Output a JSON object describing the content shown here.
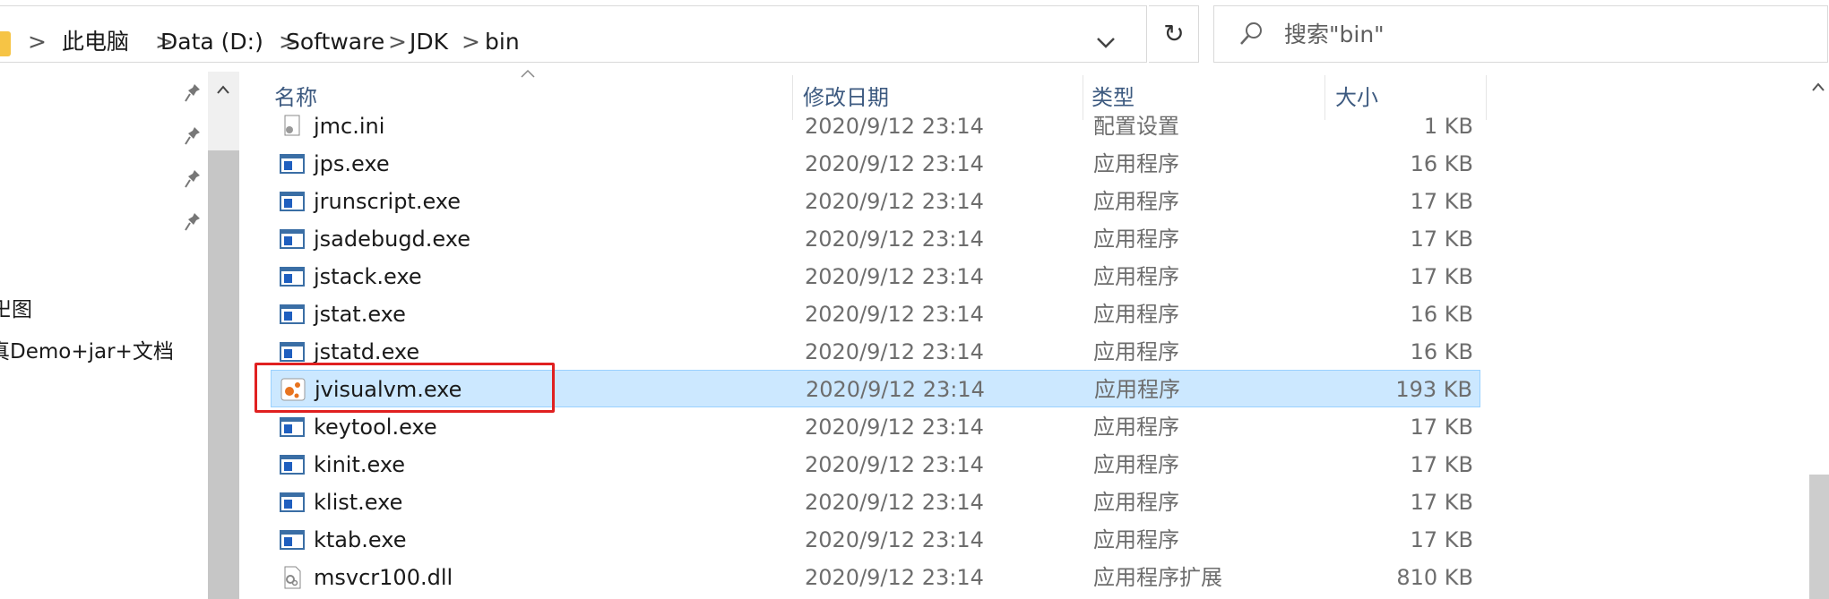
{
  "address_bar": {
    "breadcrumbs": [
      "此电脑",
      "Data (D:)",
      "Software",
      "JDK",
      "bin"
    ],
    "separator": ">",
    "search_placeholder": "搜索\"bin\"",
    "refresh_icon": "↻"
  },
  "nav_pane": {
    "items": [
      {
        "label": "卍图"
      },
      {
        "label": "真Demo+jar+文档"
      }
    ]
  },
  "file_list": {
    "columns": {
      "name": "名称",
      "date": "修改日期",
      "type": "类型",
      "size": "大小"
    },
    "rows": [
      {
        "name": "jmc.ini",
        "date": "2020/9/12 23:14",
        "type": "配置设置",
        "size": "1 KB",
        "icon": "settings-file-icon"
      },
      {
        "name": "jps.exe",
        "date": "2020/9/12 23:14",
        "type": "应用程序",
        "size": "16 KB",
        "icon": "exe-icon"
      },
      {
        "name": "jrunscript.exe",
        "date": "2020/9/12 23:14",
        "type": "应用程序",
        "size": "17 KB",
        "icon": "exe-icon"
      },
      {
        "name": "jsadebugd.exe",
        "date": "2020/9/12 23:14",
        "type": "应用程序",
        "size": "17 KB",
        "icon": "exe-icon"
      },
      {
        "name": "jstack.exe",
        "date": "2020/9/12 23:14",
        "type": "应用程序",
        "size": "17 KB",
        "icon": "exe-icon"
      },
      {
        "name": "jstat.exe",
        "date": "2020/9/12 23:14",
        "type": "应用程序",
        "size": "16 KB",
        "icon": "exe-icon"
      },
      {
        "name": "jstatd.exe",
        "date": "2020/9/12 23:14",
        "type": "应用程序",
        "size": "16 KB",
        "icon": "exe-icon"
      },
      {
        "name": "jvisualvm.exe",
        "date": "2020/9/12 23:14",
        "type": "应用程序",
        "size": "193 KB",
        "icon": "jvisualvm-icon",
        "selected": true
      },
      {
        "name": "keytool.exe",
        "date": "2020/9/12 23:14",
        "type": "应用程序",
        "size": "17 KB",
        "icon": "exe-icon"
      },
      {
        "name": "kinit.exe",
        "date": "2020/9/12 23:14",
        "type": "应用程序",
        "size": "17 KB",
        "icon": "exe-icon"
      },
      {
        "name": "klist.exe",
        "date": "2020/9/12 23:14",
        "type": "应用程序",
        "size": "17 KB",
        "icon": "exe-icon"
      },
      {
        "name": "ktab.exe",
        "date": "2020/9/12 23:14",
        "type": "应用程序",
        "size": "17 KB",
        "icon": "exe-icon"
      },
      {
        "name": "msvcr100.dll",
        "date": "2020/9/12 23:14",
        "type": "应用程序扩展",
        "size": "810 KB",
        "icon": "dll-icon"
      }
    ]
  },
  "colors": {
    "selection_bg": "#cce8ff",
    "selection_border": "#99d1ff",
    "highlight_box": "#e02020",
    "folder": "#f6c445",
    "header_text": "#3d5a80"
  }
}
